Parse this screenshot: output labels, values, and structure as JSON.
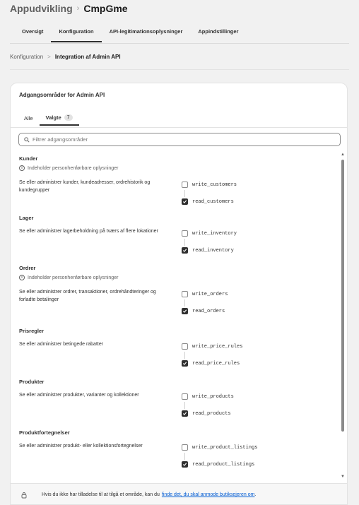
{
  "header": {
    "app_name": "Appudvikling",
    "separator": "›",
    "current": "CmpGme"
  },
  "tabs": [
    {
      "label": "Oversigt",
      "active": false
    },
    {
      "label": "Konfiguration",
      "active": true
    },
    {
      "label": "API-legitimationsoplysninger",
      "active": false
    },
    {
      "label": "Appindstillinger",
      "active": false
    }
  ],
  "breadcrumb": {
    "parent": "Konfiguration",
    "separator": ">",
    "current": "Integration af Admin API"
  },
  "card": {
    "title": "Adgangsområder for Admin API",
    "subtabs": {
      "all_label": "Alle",
      "selected_label": "Valgte",
      "selected_count": "7"
    },
    "search_placeholder": "Filtrer adgangsområder"
  },
  "sections": [
    {
      "title": "Kunder",
      "warning": "Indeholder personhenførbare oplysninger",
      "description": "Se eller administrer kunder, kundeadresser, ordrehistorik og kundegrupper",
      "write_scope": "write_customers",
      "write_checked": false,
      "read_scope": "read_customers",
      "read_checked": true
    },
    {
      "title": "Lager",
      "warning": "",
      "description": "Se eller administrer lagerbeholdning på tværs af flere lokationer",
      "write_scope": "write_inventory",
      "write_checked": false,
      "read_scope": "read_inventory",
      "read_checked": true
    },
    {
      "title": "Ordrer",
      "warning": "Indeholder personhenførbare oplysninger",
      "description": "Se eller administrer ordrer, transaktioner, ordrehåndteringer og forladte betalinger",
      "write_scope": "write_orders",
      "write_checked": false,
      "read_scope": "read_orders",
      "read_checked": true
    },
    {
      "title": "Prisregler",
      "warning": "",
      "description": "Se eller administrer betingede rabatter",
      "write_scope": "write_price_rules",
      "write_checked": false,
      "read_scope": "read_price_rules",
      "read_checked": true
    },
    {
      "title": "Produkter",
      "warning": "",
      "description": "Se eller administrer produkter, varianter og kollektioner",
      "write_scope": "write_products",
      "write_checked": false,
      "read_scope": "read_products",
      "read_checked": true
    },
    {
      "title": "Produktfortegnelser",
      "warning": "",
      "description": "Se eller administrer produkt- eller kollektionsfortegnelser",
      "write_scope": "write_product_listings",
      "write_checked": false,
      "read_scope": "read_product_listings",
      "read_checked": true
    }
  ],
  "footer": {
    "text": "Hvis du ikke har tilladelse til at tilgå et område, kan du",
    "link": "finde det, du skal anmode butiksejeren om",
    "end": "."
  }
}
